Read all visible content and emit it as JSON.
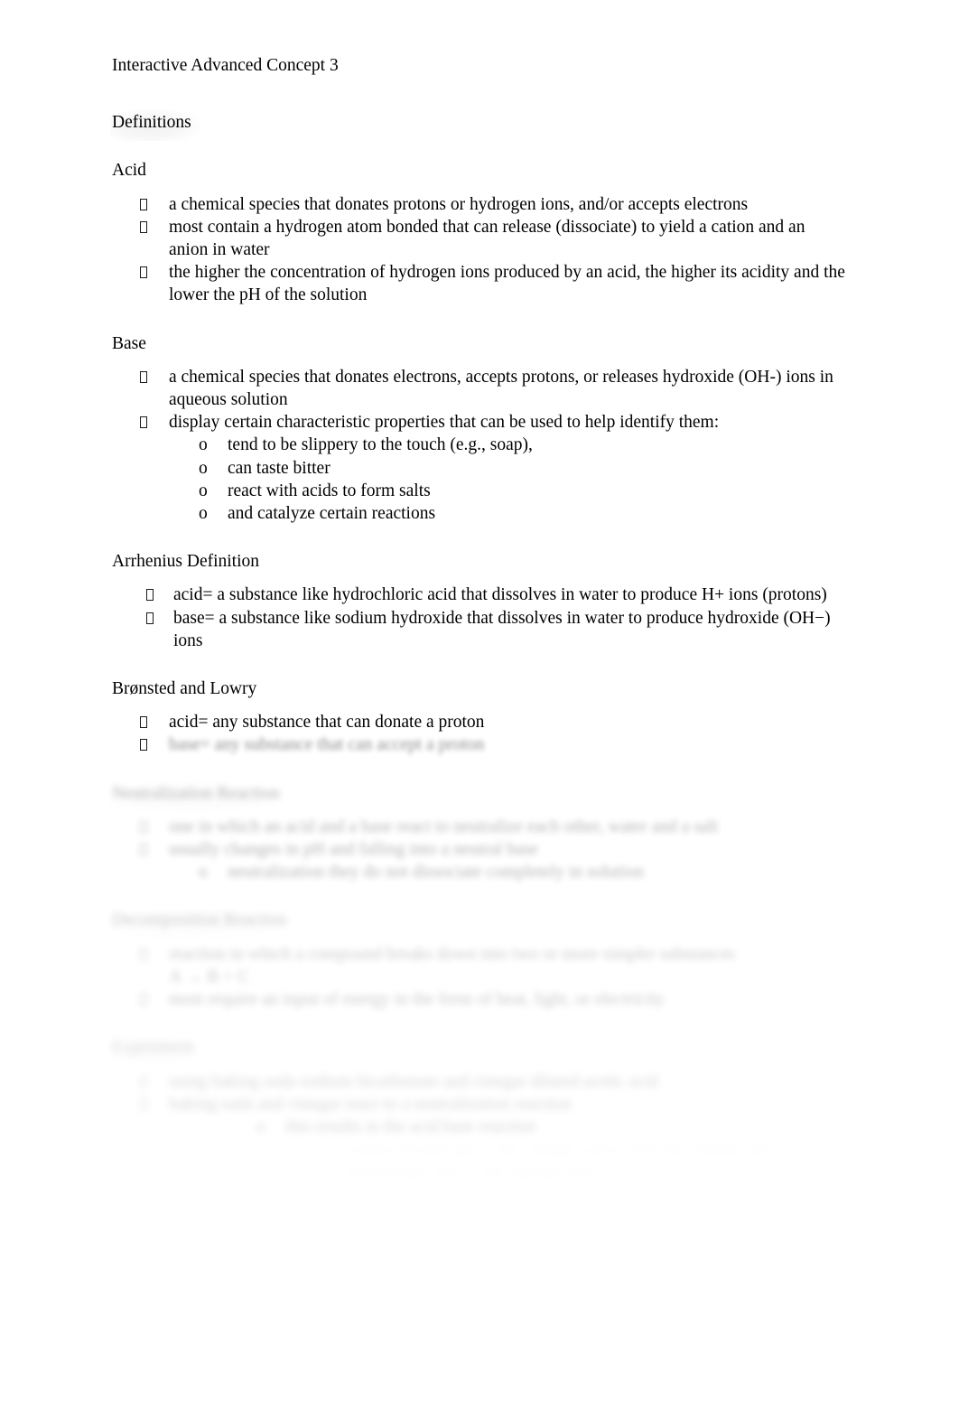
{
  "document": {
    "title": "Interactive Advanced Concept 3",
    "page_background": "#ffffff",
    "text_color": "#000000",
    "bullet_marker": "missing-glyph-box",
    "sub_bullet_marker": "o"
  },
  "sections": {
    "definitions_heading": "Definitions",
    "acid": {
      "heading": "Acid",
      "bullets": [
        "a chemical species that donates protons or hydrogen ions, and/or accepts electrons",
        "most contain a hydrogen atom bonded that can release (dissociate) to yield a cation and an anion in water",
        "the higher the concentration of hydrogen ions produced by an acid, the higher its acidity and the lower the pH of the solution"
      ]
    },
    "base": {
      "heading": "Base",
      "bullets": [
        "a chemical species that donates electrons, accepts protons, or releases hydroxide (OH-) ions in aqueous solution",
        "display certain characteristic properties that can be used to help identify them:"
      ],
      "sub_bullets": [
        "tend to be slippery to the touch (e.g., soap),",
        "can taste bitter",
        "react with acids to form salts",
        "and catalyze certain reactions"
      ]
    },
    "arrhenius": {
      "heading": "Arrhenius Definition",
      "bullets": [
        "acid= a substance like hydrochloric acid that dissolves in water to produce H+ ions (protons)",
        "base= a substance like sodium hydroxide that dissolves in water to produce hydroxide (OH−) ions"
      ]
    },
    "bronsted": {
      "heading": "Brønsted and Lowry",
      "bullets": [
        "acid= any substance that can donate a proton",
        "base= any substance that can accept a proton"
      ]
    },
    "neutralization": {
      "heading": "Neutralization Reaction",
      "bullets": [
        "one in which an acid and a base react to neutralize each other, water and a salt",
        "usually changes in pH and falling into a neutral base"
      ],
      "sub_bullets": [
        "neutralization they do not dissociate completely in solution"
      ]
    },
    "decomposition": {
      "heading": "Decomposition Reaction",
      "bullets": [
        "reaction in which a compound breaks down into two or more simpler substances",
        "A → B + C",
        "most require an input of energy in the form of heat, light, or electricity"
      ]
    },
    "experiment": {
      "heading": "Experiment",
      "bullets": [
        "using baking soda sodium bicarbonate and vinegar diluted acetic acid",
        "baking soda and vinegar react to a neutralization reaction",
        "this results in the acid base reaction",
        "carbon dioxide gas is the vinegar reacts with the sodium and bicarbonate ions in the baking soda"
      ]
    }
  }
}
